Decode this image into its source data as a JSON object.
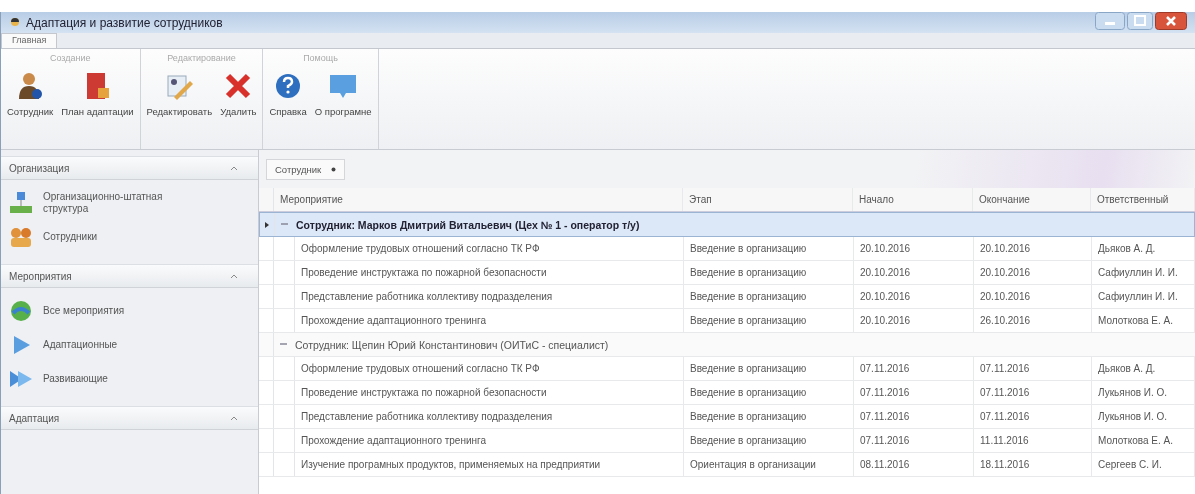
{
  "window": {
    "title": "Адаптация и развитие сотрудников"
  },
  "tabs": [
    {
      "label": "Главная",
      "selected": true
    }
  ],
  "ribbon": {
    "groups": [
      {
        "title": "Создание",
        "buttons": [
          {
            "label": "Сотрудник",
            "kind": "person"
          },
          {
            "label": "План адаптации",
            "kind": "plan"
          }
        ]
      },
      {
        "title": "Редактирование",
        "buttons": [
          {
            "label": "Редактировать",
            "kind": "edit"
          },
          {
            "label": "Удалить",
            "kind": "delete"
          }
        ]
      },
      {
        "title": "Помощь",
        "buttons": [
          {
            "label": "Справка",
            "kind": "help"
          },
          {
            "label": "О програмне",
            "kind": "about"
          }
        ]
      }
    ]
  },
  "sidebar": {
    "sections": [
      {
        "title": "Организация",
        "expanded": true,
        "items": [
          {
            "label": "Организационно-штатная структура",
            "kind": "structure"
          },
          {
            "label": "Сотрудники",
            "kind": "people"
          }
        ]
      },
      {
        "title": "Мероприятия",
        "expanded": true,
        "items": [
          {
            "label": "Все мероприятия",
            "kind": "all"
          },
          {
            "label": "Адаптационные",
            "kind": "arrow"
          },
          {
            "label": "Развивающие",
            "kind": "double-arrow"
          }
        ]
      },
      {
        "title": "Адаптация",
        "expanded": true
      }
    ]
  },
  "grid": {
    "group_by": "Сотрудник",
    "columns": [
      "Мероприятие",
      "Этап",
      "Начало",
      "Окончание",
      "Ответственный"
    ],
    "groups": [
      {
        "title": "Сотрудник: Марков Дмитрий Витальевич (Цех № 1 - оператор т/у)",
        "selected": true,
        "expanded": true,
        "rows": [
          [
            "Оформление трудовых отношений согласно ТК РФ",
            "Введение в организацию",
            "20.10.2016",
            "20.10.2016",
            "Дьяков А. Д."
          ],
          [
            "Проведение инструктажа по пожарной безопасности",
            "Введение в организацию",
            "20.10.2016",
            "20.10.2016",
            "Сафиуллин И. И."
          ],
          [
            "Представление работника коллективу подразделения",
            "Введение в организацию",
            "20.10.2016",
            "20.10.2016",
            "Сафиуллин И. И."
          ],
          [
            "Прохождение адаптационного тренинга",
            "Введение в организацию",
            "20.10.2016",
            "26.10.2016",
            "Молоткова Е. А."
          ]
        ]
      },
      {
        "title": "Сотрудник: Щепин Юрий Константинович (ОИТиС - специалист)",
        "selected": false,
        "expanded": true,
        "rows": [
          [
            "Оформление трудовых отношений согласно ТК РФ",
            "Введение в организацию",
            "07.11.2016",
            "07.11.2016",
            "Дьяков А. Д."
          ],
          [
            "Проведение инструктажа по пожарной безопасности",
            "Введение в организацию",
            "07.11.2016",
            "07.11.2016",
            "Лукьянов И. О."
          ],
          [
            "Представление работника коллективу подразделения",
            "Введение в организацию",
            "07.11.2016",
            "07.11.2016",
            "Лукьянов И. О."
          ],
          [
            "Прохождение адаптационного тренинга",
            "Введение в организацию",
            "07.11.2016",
            "11.11.2016",
            "Молоткова Е. А."
          ],
          [
            "Изучение програмных продуктов, применяемых на предприятии",
            "Ориентация в организации",
            "08.11.2016",
            "18.11.2016",
            "Сергеев С. И."
          ]
        ]
      }
    ]
  }
}
